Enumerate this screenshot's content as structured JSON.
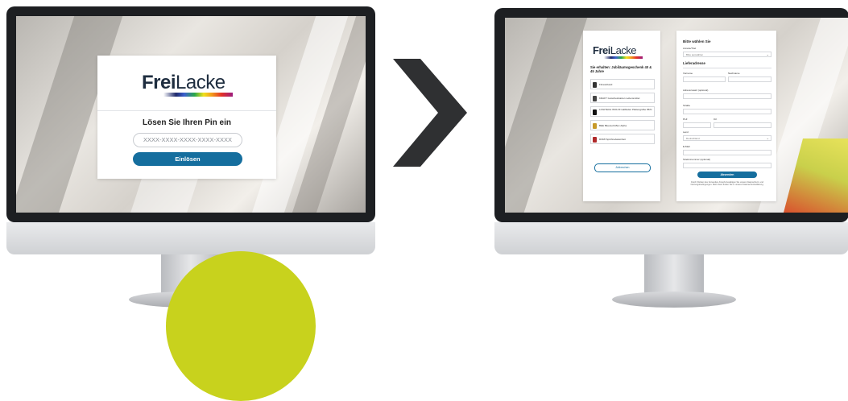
{
  "left_screen": {
    "brand": {
      "bold": "Frei",
      "light": "Lacke"
    },
    "heading": "Lösen Sie Ihren Pin ein",
    "pin_placeholder": "XXXX-XXXX-XXXX-XXXX-XXXX",
    "submit_label": "Einlösen"
  },
  "right_screen": {
    "brand": {
      "bold": "Frei",
      "light": "Lacke"
    },
    "gift_title": "Sie erhalten: Jubiläumsgeschenk 40 & 45 Jahre",
    "products": [
      "Fitnessband",
      "KRAFT Gutscheinkarten Lebensmittel",
      "LOGITECH WOLFF Halbleiter Plattengröße 95/N",
      "BEE Bluetooth-Box Alpha",
      "DOMI Sprühnebeleinheit"
    ],
    "back_button": "Abbrechen",
    "form_title": "Bitte wählen Sie",
    "salutation_label": "Anrede/Titel",
    "salutation_value": "Bitte auswählen",
    "address_title": "Lieferadresse",
    "fields": {
      "firstname": "Vorname",
      "lastname": "Nachname",
      "company": "Adresszusatz (optional)",
      "street": "Straße",
      "zip": "PLZ",
      "city": "Ort",
      "country": "Land",
      "country_value": "Deutschland",
      "email": "E-Mail",
      "phone": "Telefonnummer (optional)"
    },
    "submit_button": "Absenden",
    "legal_text": "Durch Klicken des Versenden-Knopfs bestätigen Sie unsere Datenschutz- und Nutzungsbedingungen. Mehr dazu finden Sie in unserer Datenschutzerklärung."
  }
}
